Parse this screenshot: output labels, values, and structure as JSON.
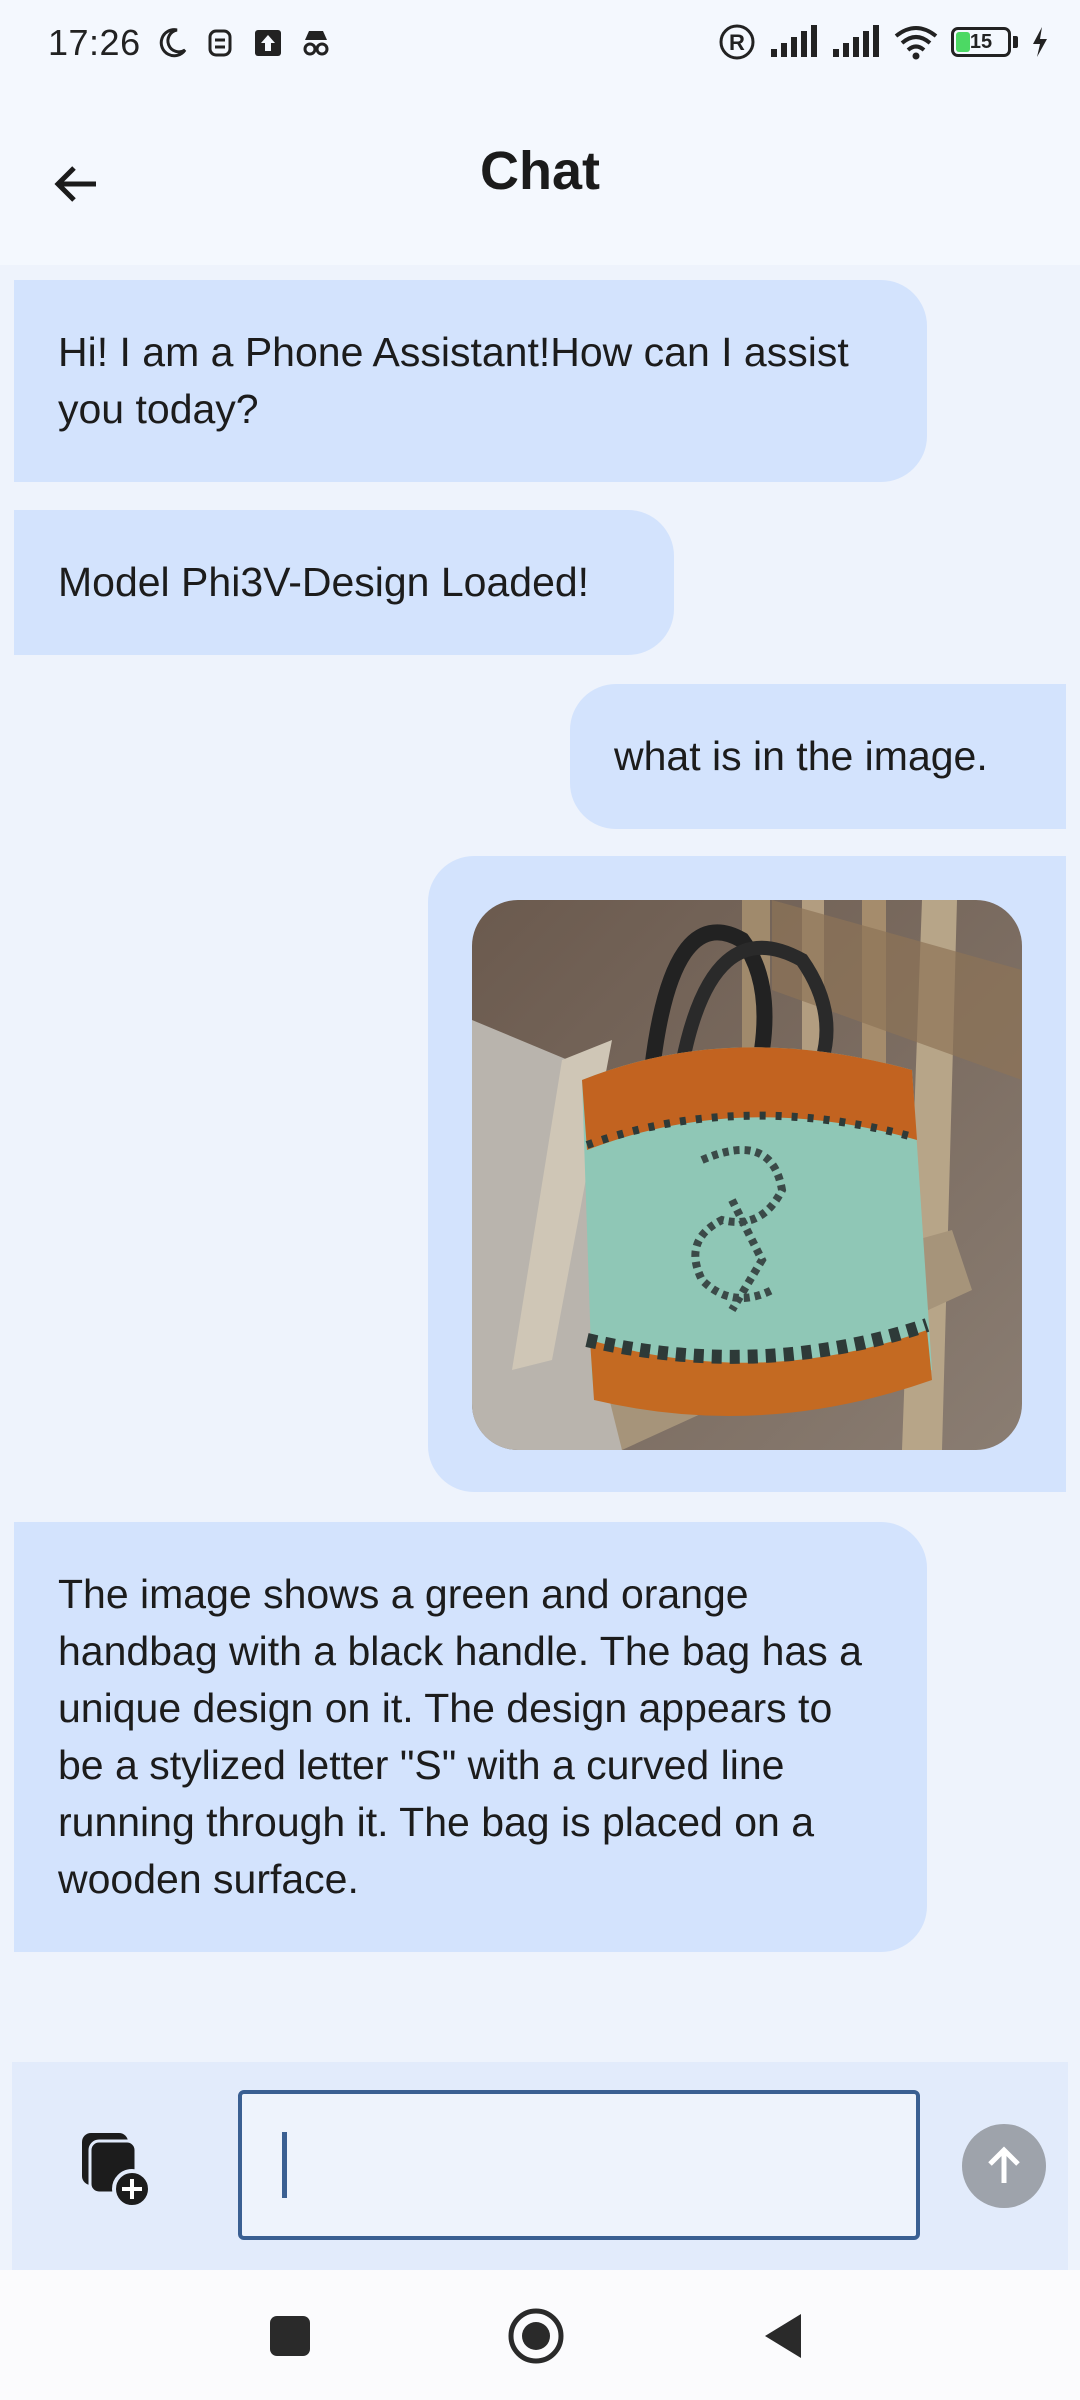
{
  "status_bar": {
    "time": "17:26",
    "left_icons": [
      "moon-icon",
      "face-unlock-icon",
      "upload-icon",
      "incognito-icon"
    ],
    "right_icons": [
      "registered-icon",
      "signal-icon",
      "signal-icon",
      "wifi-icon"
    ],
    "battery_level": "15",
    "charging": true
  },
  "header": {
    "title": "Chat",
    "back_icon": "arrow-left-icon"
  },
  "messages": [
    {
      "sender": "assistant",
      "text": "Hi! I am a Phone Assistant!How can I assist you today?"
    },
    {
      "sender": "assistant",
      "text": "Model Phi3V-Design Loaded!"
    },
    {
      "sender": "user",
      "text": "what is in the image."
    },
    {
      "sender": "user",
      "type": "image",
      "description_icon": "knitted-handbag-photo"
    },
    {
      "sender": "assistant",
      "text": "The image shows a green and orange handbag with a black handle. The bag has a unique design on it. The design appears to be a stylized letter \"S\" with a curved line running through it. The bag is placed on a wooden surface."
    }
  ],
  "composer": {
    "input_value": "",
    "attach_icon": "add-image-icon",
    "send_icon": "arrow-up-icon"
  },
  "nav": {
    "buttons": [
      "recents-square-icon",
      "home-circle-icon",
      "back-triangle-icon"
    ]
  },
  "colors": {
    "background": "#eef3fc",
    "bubble": "#d3e3fd",
    "input_border": "#3a5f92",
    "send_disabled": "#9ea3ab",
    "battery": "#4cd964"
  }
}
